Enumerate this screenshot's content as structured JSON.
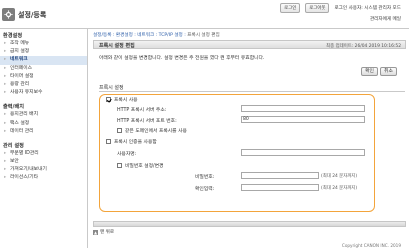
{
  "app": {
    "title": "설정/등록",
    "user_text": "로그인 사용자: 시스템 관리자 모드",
    "logout_label": "로그아웃",
    "login_label": "로그인",
    "admin_link": "관리자에게 메일"
  },
  "sidebar": {
    "groups": [
      {
        "title": "환경설정",
        "items": [
          "조작 메뉴",
          "급지 설정",
          "네트워크",
          "인터페이스",
          "타이머 설정",
          "용량 관리",
          "사용자 유지보수"
        ],
        "active": 2
      },
      {
        "title": "출력/배치",
        "items": [
          "용지관리 배치",
          "팩스 설정",
          "데이터 관리"
        ],
        "active": -1
      },
      {
        "title": "관리 설정",
        "items": [
          "부문별 ID관리",
          "보안",
          "가져오기/내보내기",
          "라이선스/기타"
        ],
        "active": -1
      }
    ]
  },
  "main": {
    "breadcrumb_prefix": "설정/등록 : 환경설정 : 네트워크 : TCP/IP 설정 : ",
    "breadcrumb_current": "프록시 설정 편집",
    "section_title": "프록시 설정 편집",
    "last_update": "최종 업데이트: 26/04 2019 10:16:52",
    "description": "아래와 같이 설정을 변경합니다. 설정 변경은 주 전원을 껐다 켠 후부터 유효합니다.",
    "ok_label": "확인",
    "cancel_label": "취소",
    "subsection_title": "프록시 설정",
    "use_proxy_label": "프록시 사용",
    "server_address_label": "HTTP 프록시 서버 주소:",
    "server_address_value": "",
    "server_port_label": "HTTP 프록시 서버 포트 번호:",
    "server_port_value": "80",
    "same_domain_label": "같은 도메인에서 프록시를 사용",
    "use_auth_label": "프록시 인증을 사용함",
    "username_label": "사용자명:",
    "username_value": "",
    "set_password_label": "비밀번호 설정/변경",
    "password_label": "비밀번호:",
    "password_value": "",
    "password_hint": "(최대 24 문자까지)",
    "confirm_label": "확인입력:",
    "confirm_value": "",
    "confirm_hint": "(최대 24 문자까지)",
    "back_to_top": "맨 위로",
    "copyright": "Copyright CANON INC. 2019"
  },
  "state": {
    "use_proxy_checked": true,
    "same_domain_checked": false,
    "use_auth_checked": false,
    "set_password_checked": false
  },
  "colors": {
    "highlight_border": "#f3a43b",
    "active_item_bg": "#d9e5f3",
    "link": "#2a5ca8"
  }
}
